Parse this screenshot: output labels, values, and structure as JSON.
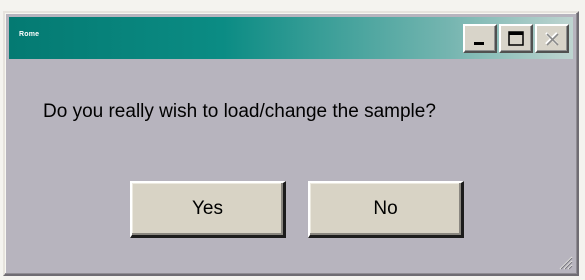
{
  "window": {
    "title": "Rome"
  },
  "titlebar": {
    "buttons": [
      {
        "name": "minimize",
        "icon": "minimize-icon"
      },
      {
        "name": "maximize",
        "icon": "maximize-icon"
      },
      {
        "name": "close",
        "icon": "close-icon",
        "disabled": true
      }
    ]
  },
  "dialog": {
    "message": "Do you really wish to load/change the sample?",
    "yes_label": "Yes",
    "no_label": "No"
  },
  "colors": {
    "titlebar_start": "#047a72",
    "titlebar_end": "#bed4d0",
    "dialog_background": "#b7b4be",
    "button_face": "#d8d3c5"
  }
}
